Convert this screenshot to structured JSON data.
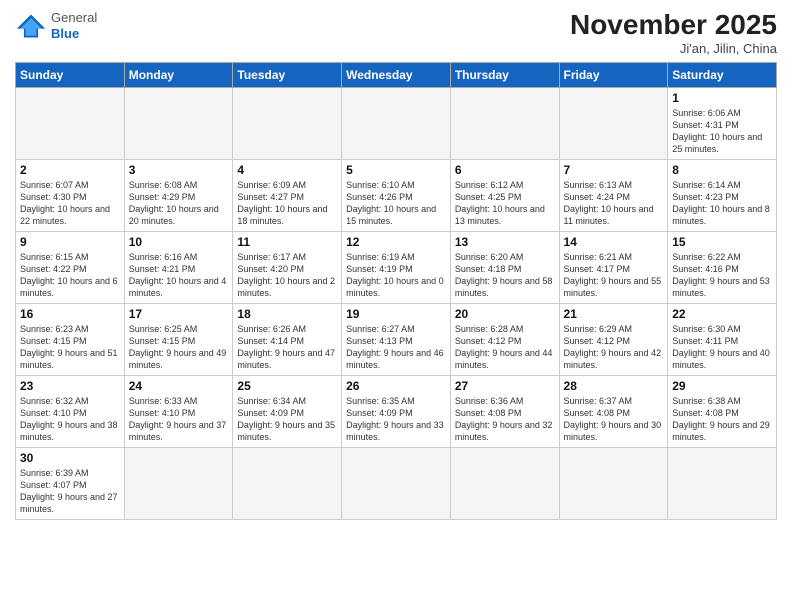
{
  "header": {
    "logo_general": "General",
    "logo_blue": "Blue",
    "month_title": "November 2025",
    "subtitle": "Ji'an, Jilin, China"
  },
  "weekdays": [
    "Sunday",
    "Monday",
    "Tuesday",
    "Wednesday",
    "Thursday",
    "Friday",
    "Saturday"
  ],
  "weeks": [
    [
      {
        "day": "",
        "info": ""
      },
      {
        "day": "",
        "info": ""
      },
      {
        "day": "",
        "info": ""
      },
      {
        "day": "",
        "info": ""
      },
      {
        "day": "",
        "info": ""
      },
      {
        "day": "",
        "info": ""
      },
      {
        "day": "1",
        "info": "Sunrise: 6:06 AM\nSunset: 4:31 PM\nDaylight: 10 hours\nand 25 minutes."
      }
    ],
    [
      {
        "day": "2",
        "info": "Sunrise: 6:07 AM\nSunset: 4:30 PM\nDaylight: 10 hours\nand 22 minutes."
      },
      {
        "day": "3",
        "info": "Sunrise: 6:08 AM\nSunset: 4:29 PM\nDaylight: 10 hours\nand 20 minutes."
      },
      {
        "day": "4",
        "info": "Sunrise: 6:09 AM\nSunset: 4:27 PM\nDaylight: 10 hours\nand 18 minutes."
      },
      {
        "day": "5",
        "info": "Sunrise: 6:10 AM\nSunset: 4:26 PM\nDaylight: 10 hours\nand 15 minutes."
      },
      {
        "day": "6",
        "info": "Sunrise: 6:12 AM\nSunset: 4:25 PM\nDaylight: 10 hours\nand 13 minutes."
      },
      {
        "day": "7",
        "info": "Sunrise: 6:13 AM\nSunset: 4:24 PM\nDaylight: 10 hours\nand 11 minutes."
      },
      {
        "day": "8",
        "info": "Sunrise: 6:14 AM\nSunset: 4:23 PM\nDaylight: 10 hours\nand 8 minutes."
      }
    ],
    [
      {
        "day": "9",
        "info": "Sunrise: 6:15 AM\nSunset: 4:22 PM\nDaylight: 10 hours\nand 6 minutes."
      },
      {
        "day": "10",
        "info": "Sunrise: 6:16 AM\nSunset: 4:21 PM\nDaylight: 10 hours\nand 4 minutes."
      },
      {
        "day": "11",
        "info": "Sunrise: 6:17 AM\nSunset: 4:20 PM\nDaylight: 10 hours\nand 2 minutes."
      },
      {
        "day": "12",
        "info": "Sunrise: 6:19 AM\nSunset: 4:19 PM\nDaylight: 10 hours\nand 0 minutes."
      },
      {
        "day": "13",
        "info": "Sunrise: 6:20 AM\nSunset: 4:18 PM\nDaylight: 9 hours\nand 58 minutes."
      },
      {
        "day": "14",
        "info": "Sunrise: 6:21 AM\nSunset: 4:17 PM\nDaylight: 9 hours\nand 55 minutes."
      },
      {
        "day": "15",
        "info": "Sunrise: 6:22 AM\nSunset: 4:16 PM\nDaylight: 9 hours\nand 53 minutes."
      }
    ],
    [
      {
        "day": "16",
        "info": "Sunrise: 6:23 AM\nSunset: 4:15 PM\nDaylight: 9 hours\nand 51 minutes."
      },
      {
        "day": "17",
        "info": "Sunrise: 6:25 AM\nSunset: 4:15 PM\nDaylight: 9 hours\nand 49 minutes."
      },
      {
        "day": "18",
        "info": "Sunrise: 6:26 AM\nSunset: 4:14 PM\nDaylight: 9 hours\nand 47 minutes."
      },
      {
        "day": "19",
        "info": "Sunrise: 6:27 AM\nSunset: 4:13 PM\nDaylight: 9 hours\nand 46 minutes."
      },
      {
        "day": "20",
        "info": "Sunrise: 6:28 AM\nSunset: 4:12 PM\nDaylight: 9 hours\nand 44 minutes."
      },
      {
        "day": "21",
        "info": "Sunrise: 6:29 AM\nSunset: 4:12 PM\nDaylight: 9 hours\nand 42 minutes."
      },
      {
        "day": "22",
        "info": "Sunrise: 6:30 AM\nSunset: 4:11 PM\nDaylight: 9 hours\nand 40 minutes."
      }
    ],
    [
      {
        "day": "23",
        "info": "Sunrise: 6:32 AM\nSunset: 4:10 PM\nDaylight: 9 hours\nand 38 minutes."
      },
      {
        "day": "24",
        "info": "Sunrise: 6:33 AM\nSunset: 4:10 PM\nDaylight: 9 hours\nand 37 minutes."
      },
      {
        "day": "25",
        "info": "Sunrise: 6:34 AM\nSunset: 4:09 PM\nDaylight: 9 hours\nand 35 minutes."
      },
      {
        "day": "26",
        "info": "Sunrise: 6:35 AM\nSunset: 4:09 PM\nDaylight: 9 hours\nand 33 minutes."
      },
      {
        "day": "27",
        "info": "Sunrise: 6:36 AM\nSunset: 4:08 PM\nDaylight: 9 hours\nand 32 minutes."
      },
      {
        "day": "28",
        "info": "Sunrise: 6:37 AM\nSunset: 4:08 PM\nDaylight: 9 hours\nand 30 minutes."
      },
      {
        "day": "29",
        "info": "Sunrise: 6:38 AM\nSunset: 4:08 PM\nDaylight: 9 hours\nand 29 minutes."
      }
    ],
    [
      {
        "day": "30",
        "info": "Sunrise: 6:39 AM\nSunset: 4:07 PM\nDaylight: 9 hours\nand 27 minutes."
      },
      {
        "day": "",
        "info": ""
      },
      {
        "day": "",
        "info": ""
      },
      {
        "day": "",
        "info": ""
      },
      {
        "day": "",
        "info": ""
      },
      {
        "day": "",
        "info": ""
      },
      {
        "day": "",
        "info": ""
      }
    ]
  ]
}
